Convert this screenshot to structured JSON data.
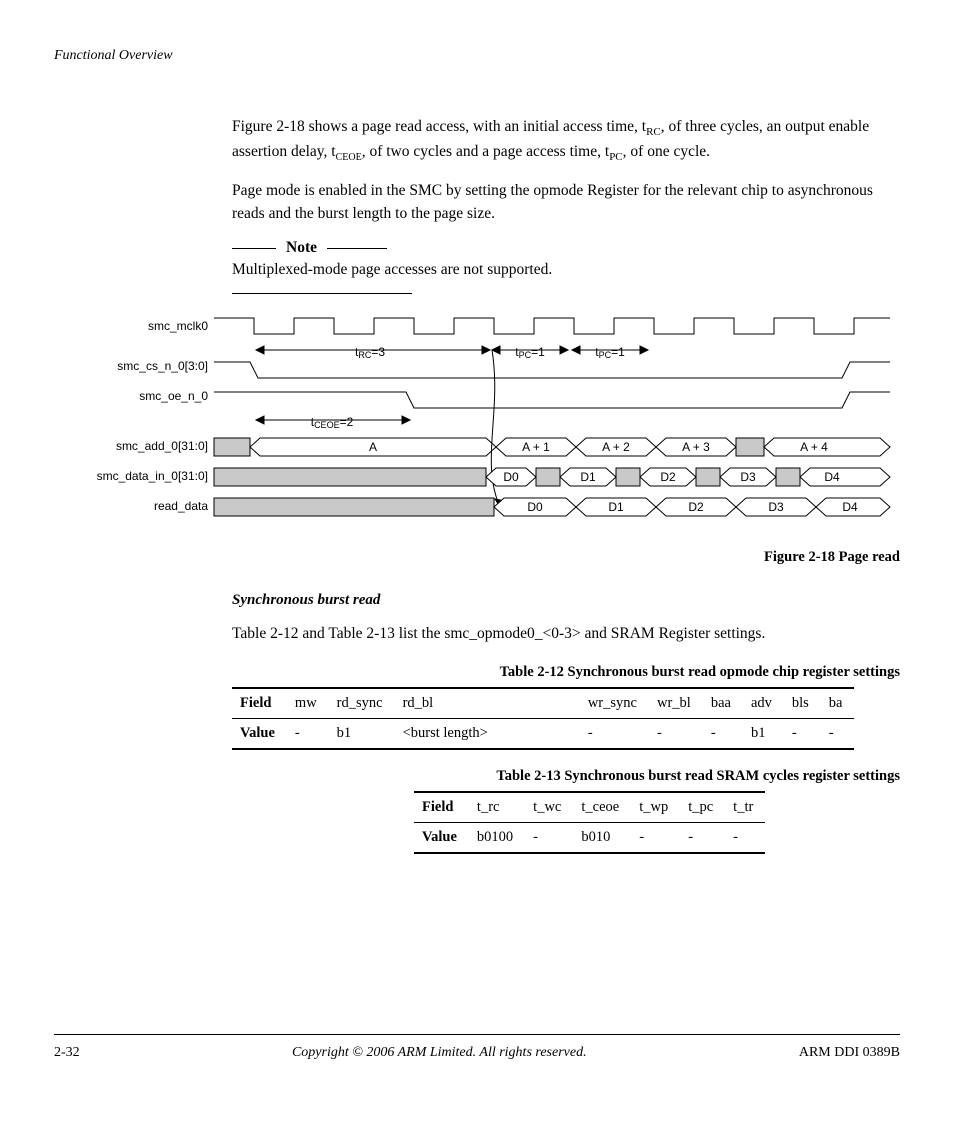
{
  "header": "Functional Overview",
  "paragraph1_a": "Figure 2-18 shows a page read access, with an initial access time, t",
  "paragraph1_sub1": "RC",
  "paragraph1_b": ", of three cycles, an output enable assertion delay, t",
  "paragraph1_sub2": "CEOE",
  "paragraph1_c": ", of two cycles and a page access time, t",
  "paragraph1_sub3": "PC",
  "paragraph1_d": ", of one cycle.",
  "paragraph2": "Page mode is enabled in the SMC by setting the opmode Register for the relevant chip to asynchronous reads and the burst length to the page size.",
  "note_label": "Note",
  "note_body": "Multiplexed-mode page accesses are not supported.",
  "figure_caption": "Figure 2-18 Page read",
  "subheading": "Synchronous burst read",
  "paragraph3": "Table 2-12 and Table 2-13 list the smc_opmode0_<0-3> and SRAM Register settings.",
  "table12_caption": "Table 2-12 Synchronous burst read opmode chip register settings",
  "table13_caption": "Table 2-13 Synchronous burst read SRAM cycles register settings",
  "signals": {
    "s0": "smc_mclk0",
    "s1": "smc_cs_n_0[3:0]",
    "s2": "smc_oe_n_0",
    "s3": "smc_add_0[31:0]",
    "s4": "smc_data_in_0[31:0]",
    "s5": "read_data"
  },
  "diagram_labels": {
    "trc": "tRC=3",
    "tpc1": "tPC=1",
    "tpc2": "tPC=1",
    "tceoe": "tCEOE=2",
    "A": "A",
    "A1": "A + 1",
    "A2": "A + 2",
    "A3": "A + 3",
    "A4": "A + 4",
    "D0": "D0",
    "D1": "D1",
    "D2": "D2",
    "D3": "D3",
    "D4": "D4"
  },
  "table12": {
    "row_label_field": "Field",
    "row_label_value": "Value",
    "headers": [
      "mw",
      "rd_sync",
      "rd_bl",
      "",
      "wr_sync",
      "wr_bl",
      "baa",
      "adv",
      "bls",
      "ba"
    ],
    "values": [
      "-",
      "b1",
      "<burst length>",
      "",
      "-",
      "-",
      "-",
      "b1",
      "-",
      "-"
    ]
  },
  "table13": {
    "row_label_field": "Field",
    "row_label_value": "Value",
    "headers": [
      "t_rc",
      "t_wc",
      "t_ceoe",
      "t_wp",
      "t_pc",
      "t_tr"
    ],
    "values": [
      "b0100",
      "-",
      "b010",
      "-",
      "-",
      "-"
    ]
  },
  "footer": {
    "left": "2-32",
    "center": "Copyright © 2006 ARM Limited. All rights reserved.",
    "right": "ARM DDI 0389B"
  }
}
